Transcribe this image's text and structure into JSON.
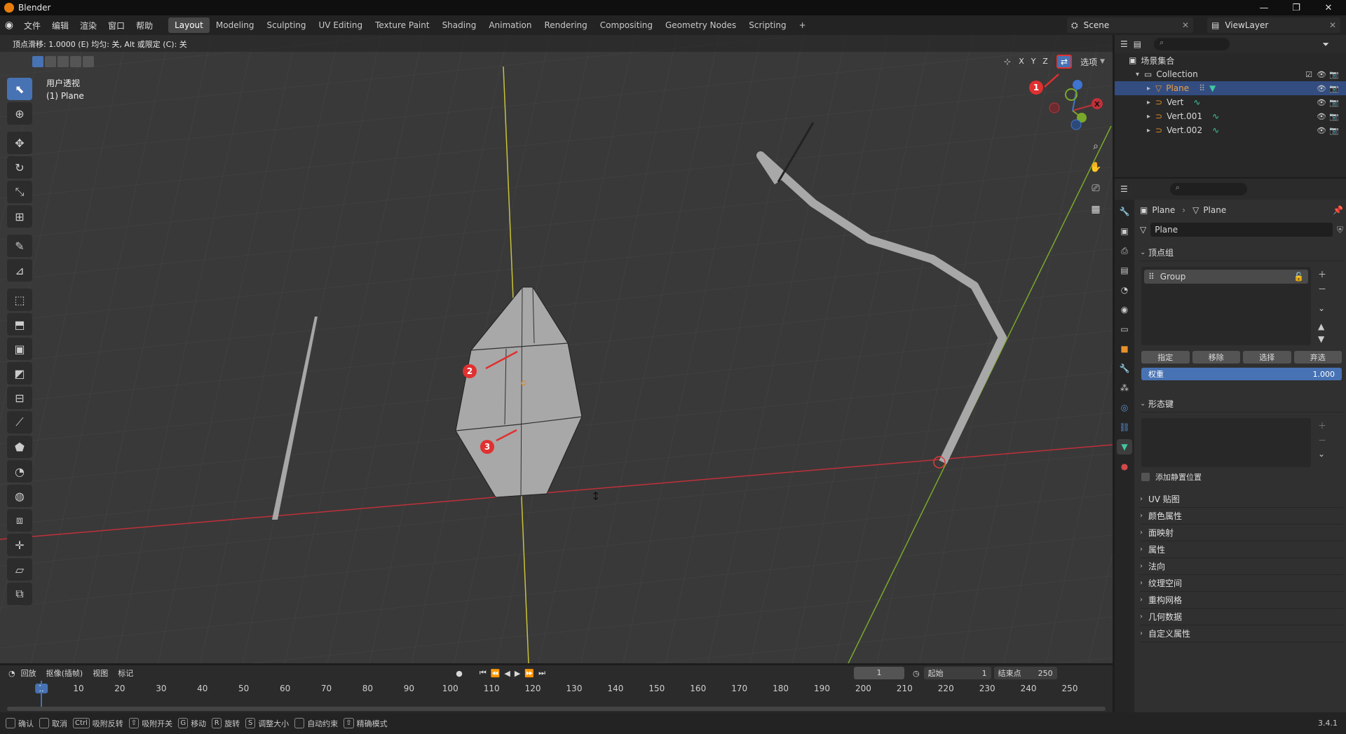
{
  "window": {
    "title": "Blender",
    "minimize": "—",
    "restore": "❐",
    "close": "✕"
  },
  "menu": [
    "文件",
    "编辑",
    "渲染",
    "窗口",
    "帮助"
  ],
  "workspaces": [
    "Layout",
    "Modeling",
    "Sculpting",
    "UV Editing",
    "Texture Paint",
    "Shading",
    "Animation",
    "Rendering",
    "Compositing",
    "Geometry Nodes",
    "Scripting",
    "+"
  ],
  "active_workspace": "Layout",
  "scene": {
    "name": "Scene"
  },
  "view_layer": {
    "name": "ViewLayer"
  },
  "viewport": {
    "operator_status": "顶点滑移: 1.0000 (E) 均匀: 关, Alt 或限定 (C): 关",
    "view_name": "用户透视",
    "object_label": "(1) Plane",
    "options_label": "选项",
    "axis_x": "X",
    "axis_y": "Y",
    "axis_z": "Z",
    "markers": [
      "1",
      "2",
      "3"
    ]
  },
  "outliner": {
    "root": "场景集合",
    "collection": "Collection",
    "items": [
      {
        "name": "Plane",
        "selected": true
      },
      {
        "name": "Vert",
        "selected": false
      },
      {
        "name": "Vert.001",
        "selected": false
      },
      {
        "name": "Vert.002",
        "selected": false
      }
    ]
  },
  "properties": {
    "breadcrumb_object": "Plane",
    "breadcrumb_data": "Plane",
    "data_name": "Plane",
    "vertex_groups_title": "顶点组",
    "vertex_group_item": "Group",
    "btn_assign": "指定",
    "btn_remove": "移除",
    "btn_select": "选择",
    "btn_deselect": "弃选",
    "weight_label": "权重",
    "weight_value": "1.000",
    "shape_keys_title": "形态键",
    "add_rest_position": "添加静置位置",
    "panels": [
      "UV 贴图",
      "颜色属性",
      "面映射",
      "属性",
      "法向",
      "纹理空间",
      "重构网格",
      "几何数据",
      "自定义属性"
    ]
  },
  "timeline": {
    "playback": "回放",
    "keying": "抠像(插帧)",
    "view": "视图",
    "marker": "标记",
    "current_frame": "1",
    "start_label": "起始",
    "start_value": "1",
    "end_label": "结束点",
    "end_value": "250",
    "ticks": [
      "1",
      "10",
      "20",
      "30",
      "40",
      "50",
      "60",
      "70",
      "80",
      "90",
      "100",
      "110",
      "120",
      "130",
      "140",
      "150",
      "160",
      "170",
      "180",
      "190",
      "200",
      "210",
      "220",
      "230",
      "240",
      "250"
    ]
  },
  "statusbar": {
    "items": [
      {
        "key": "",
        "label": "确认"
      },
      {
        "key": "",
        "label": "取消"
      },
      {
        "key": "Ctrl",
        "label": "吸附反转"
      },
      {
        "key": "⇧",
        "label": "吸附开关"
      },
      {
        "key": "G",
        "label": "移动"
      },
      {
        "key": "R",
        "label": "旋转"
      },
      {
        "key": "S",
        "label": "调整大小"
      },
      {
        "key": "",
        "label": "自动约束"
      },
      {
        "key": "⇧",
        "label": "精确模式"
      }
    ],
    "version": "3.4.1"
  },
  "colors": {
    "accent": "#4772b3",
    "selected_row": "#334d80",
    "x_axis": "#c0303a",
    "y_axis": "#7aa82a",
    "z_axis": "#3f74d0",
    "marker": "#e03030"
  }
}
